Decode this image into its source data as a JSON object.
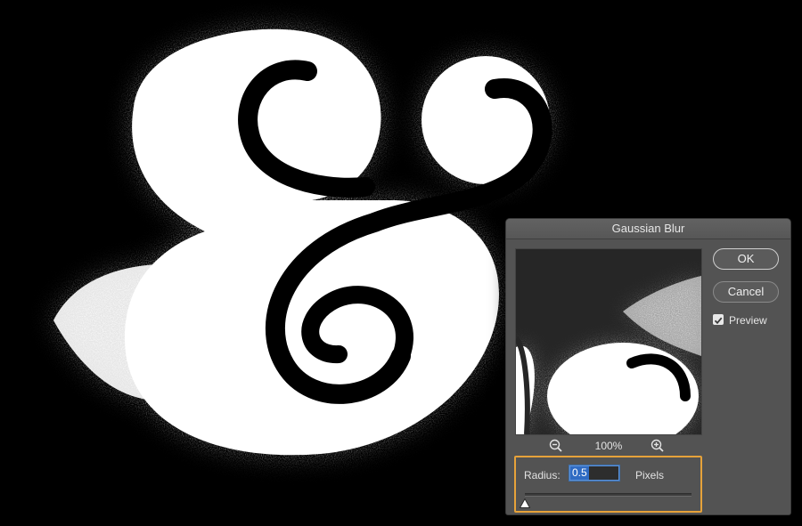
{
  "dialog": {
    "title": "Gaussian Blur",
    "ok_label": "OK",
    "cancel_label": "Cancel",
    "preview_label": "Preview",
    "preview_checked": true,
    "zoom_level": "100%",
    "radius_label": "Radius:",
    "radius_value": "0.5",
    "radius_units": "Pixels",
    "slider_fraction": 0.0
  },
  "colors": {
    "highlight_border": "#e6a23a",
    "dialog_bg": "#535353",
    "input_selection": "#2f6bc3"
  },
  "icons": {
    "zoom_out": "zoom-out-icon",
    "zoom_in": "zoom-in-icon",
    "checkmark": "checkmark-icon",
    "slider_thumb": "triangle-up-icon"
  }
}
